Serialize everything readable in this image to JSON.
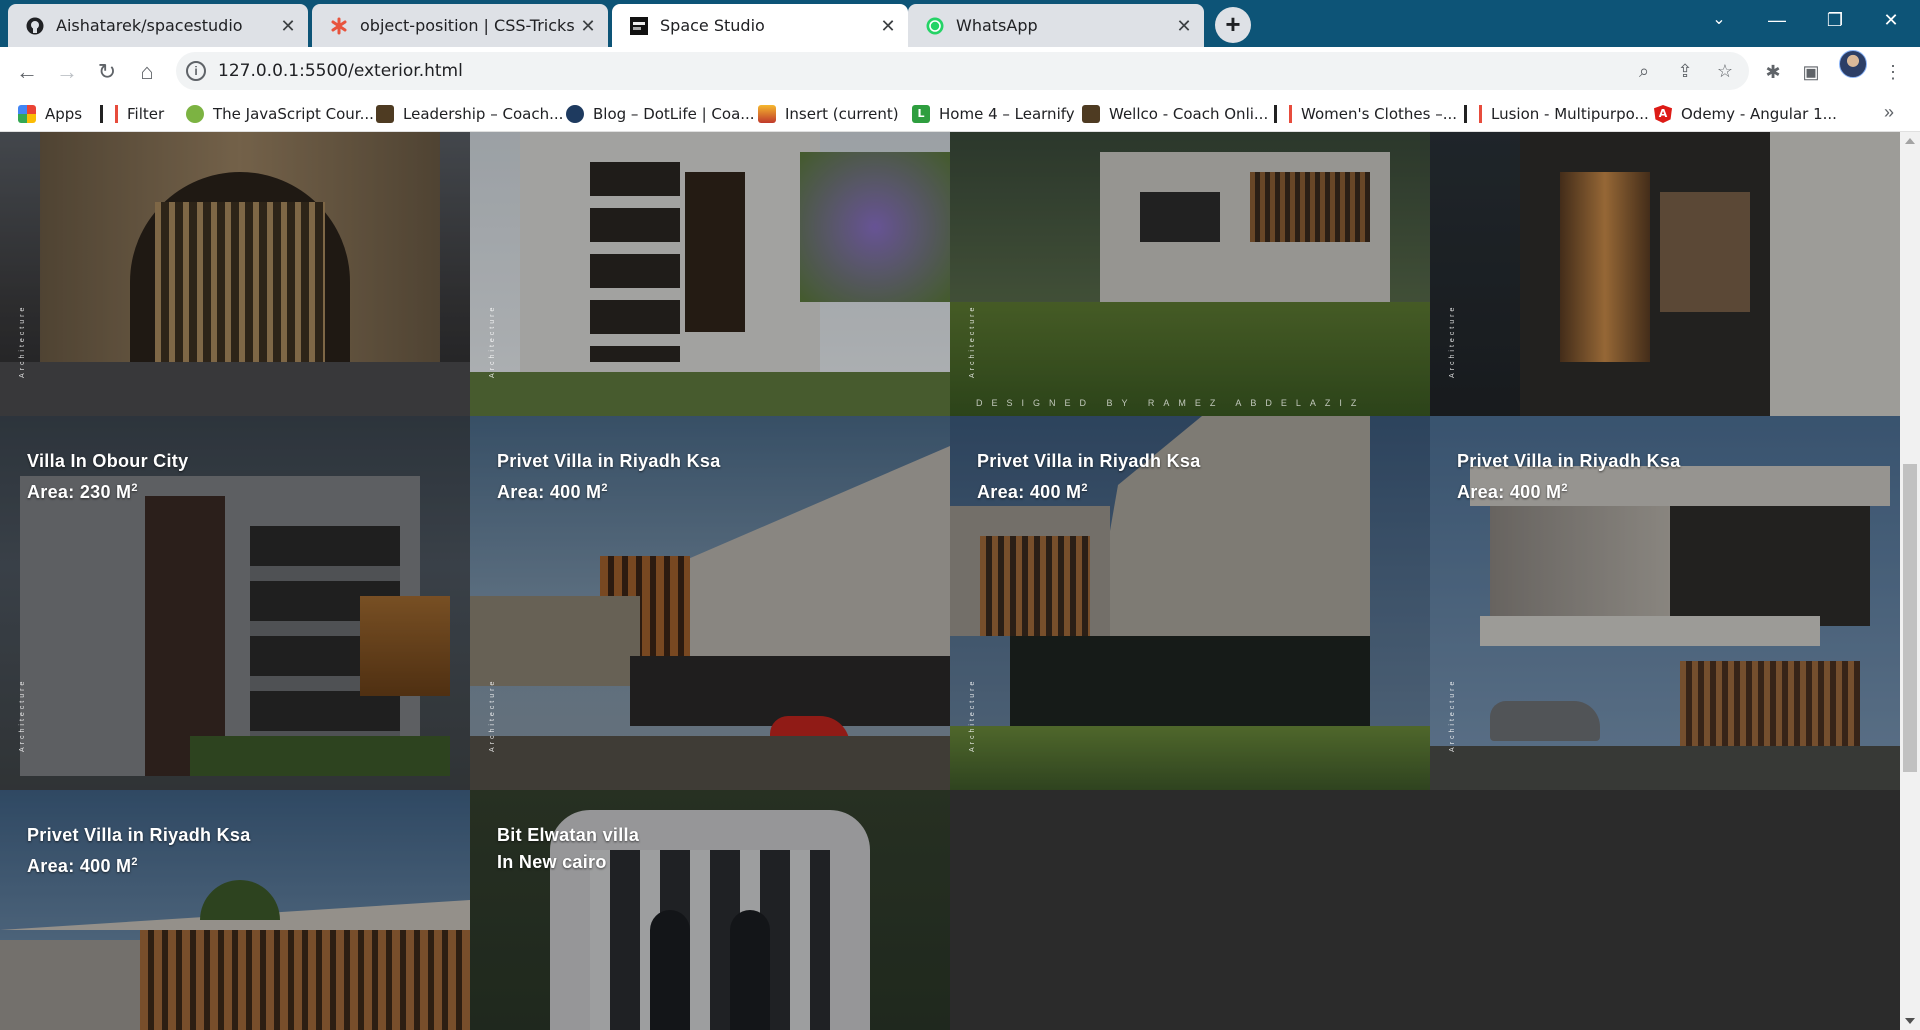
{
  "colors": {
    "tabstrip_bg": "#0d5477",
    "page_bg": "#2b2b2b",
    "caption_text": "#ffffff"
  },
  "tabs": [
    {
      "title": "Aishatarek/spacestudio",
      "icon": "github-icon"
    },
    {
      "title": "object-position | CSS-Tricks - CSS",
      "icon": "css-tricks-icon"
    },
    {
      "title": "Space Studio",
      "icon": "space-studio-icon"
    },
    {
      "title": "WhatsApp",
      "icon": "whatsapp-icon"
    }
  ],
  "active_tab": "Space Studio",
  "address": {
    "url": "127.0.0.1:5500/exterior.html"
  },
  "bookmarks": [
    {
      "label": "Apps",
      "icon": "apps-grid-icon"
    },
    {
      "label": "Filter",
      "icon": "bookmark-icon"
    },
    {
      "label": "The JavaScript Cour...",
      "icon": "bookmark-icon"
    },
    {
      "label": "Leadership – Coach...",
      "icon": "bookmark-icon"
    },
    {
      "label": "Blog – DotLife | Coa...",
      "icon": "bookmark-icon"
    },
    {
      "label": "Insert (current)",
      "icon": "bookmark-icon"
    },
    {
      "label": "Home 4 – Learnify",
      "icon": "bookmark-icon"
    },
    {
      "label": "Wellco - Coach Onli...",
      "icon": "bookmark-icon"
    },
    {
      "label": "Women's Clothes –...",
      "icon": "bookmark-icon"
    },
    {
      "label": "Lusion - Multipurpo...",
      "icon": "bookmark-icon"
    },
    {
      "label": "Odemy - Angular 1...",
      "icon": "angular-icon"
    }
  ],
  "gallery": {
    "tiles": [
      {
        "line1": "",
        "line2": "",
        "area": ""
      },
      {
        "line1": "",
        "line2": "",
        "area": ""
      },
      {
        "line1": "",
        "line2": "",
        "area": ""
      },
      {
        "line1": "",
        "line2": "",
        "area": ""
      },
      {
        "line1": "Villa In Obour City",
        "line2": "Area: 230 M",
        "sup": "2"
      },
      {
        "line1": "Privet Villa in Riyadh Ksa",
        "line2": "Area: 400 M",
        "sup": "2"
      },
      {
        "line1": "Privet Villa in Riyadh Ksa",
        "line2": "Area: 400 M",
        "sup": "2"
      },
      {
        "line1": "Privet Villa in Riyadh Ksa",
        "line2": "Area: 400 M",
        "sup": "2"
      },
      {
        "line1": "Privet Villa in Riyadh Ksa",
        "line2": "Area: 400 M",
        "sup": "2"
      },
      {
        "line1": "Bit Elwatan villa",
        "line2": "In New cairo",
        "sup": ""
      }
    ],
    "vertical_label": "Architecture",
    "signature": "DESIGNED BY RAMEZ ABDELAZIZ"
  }
}
